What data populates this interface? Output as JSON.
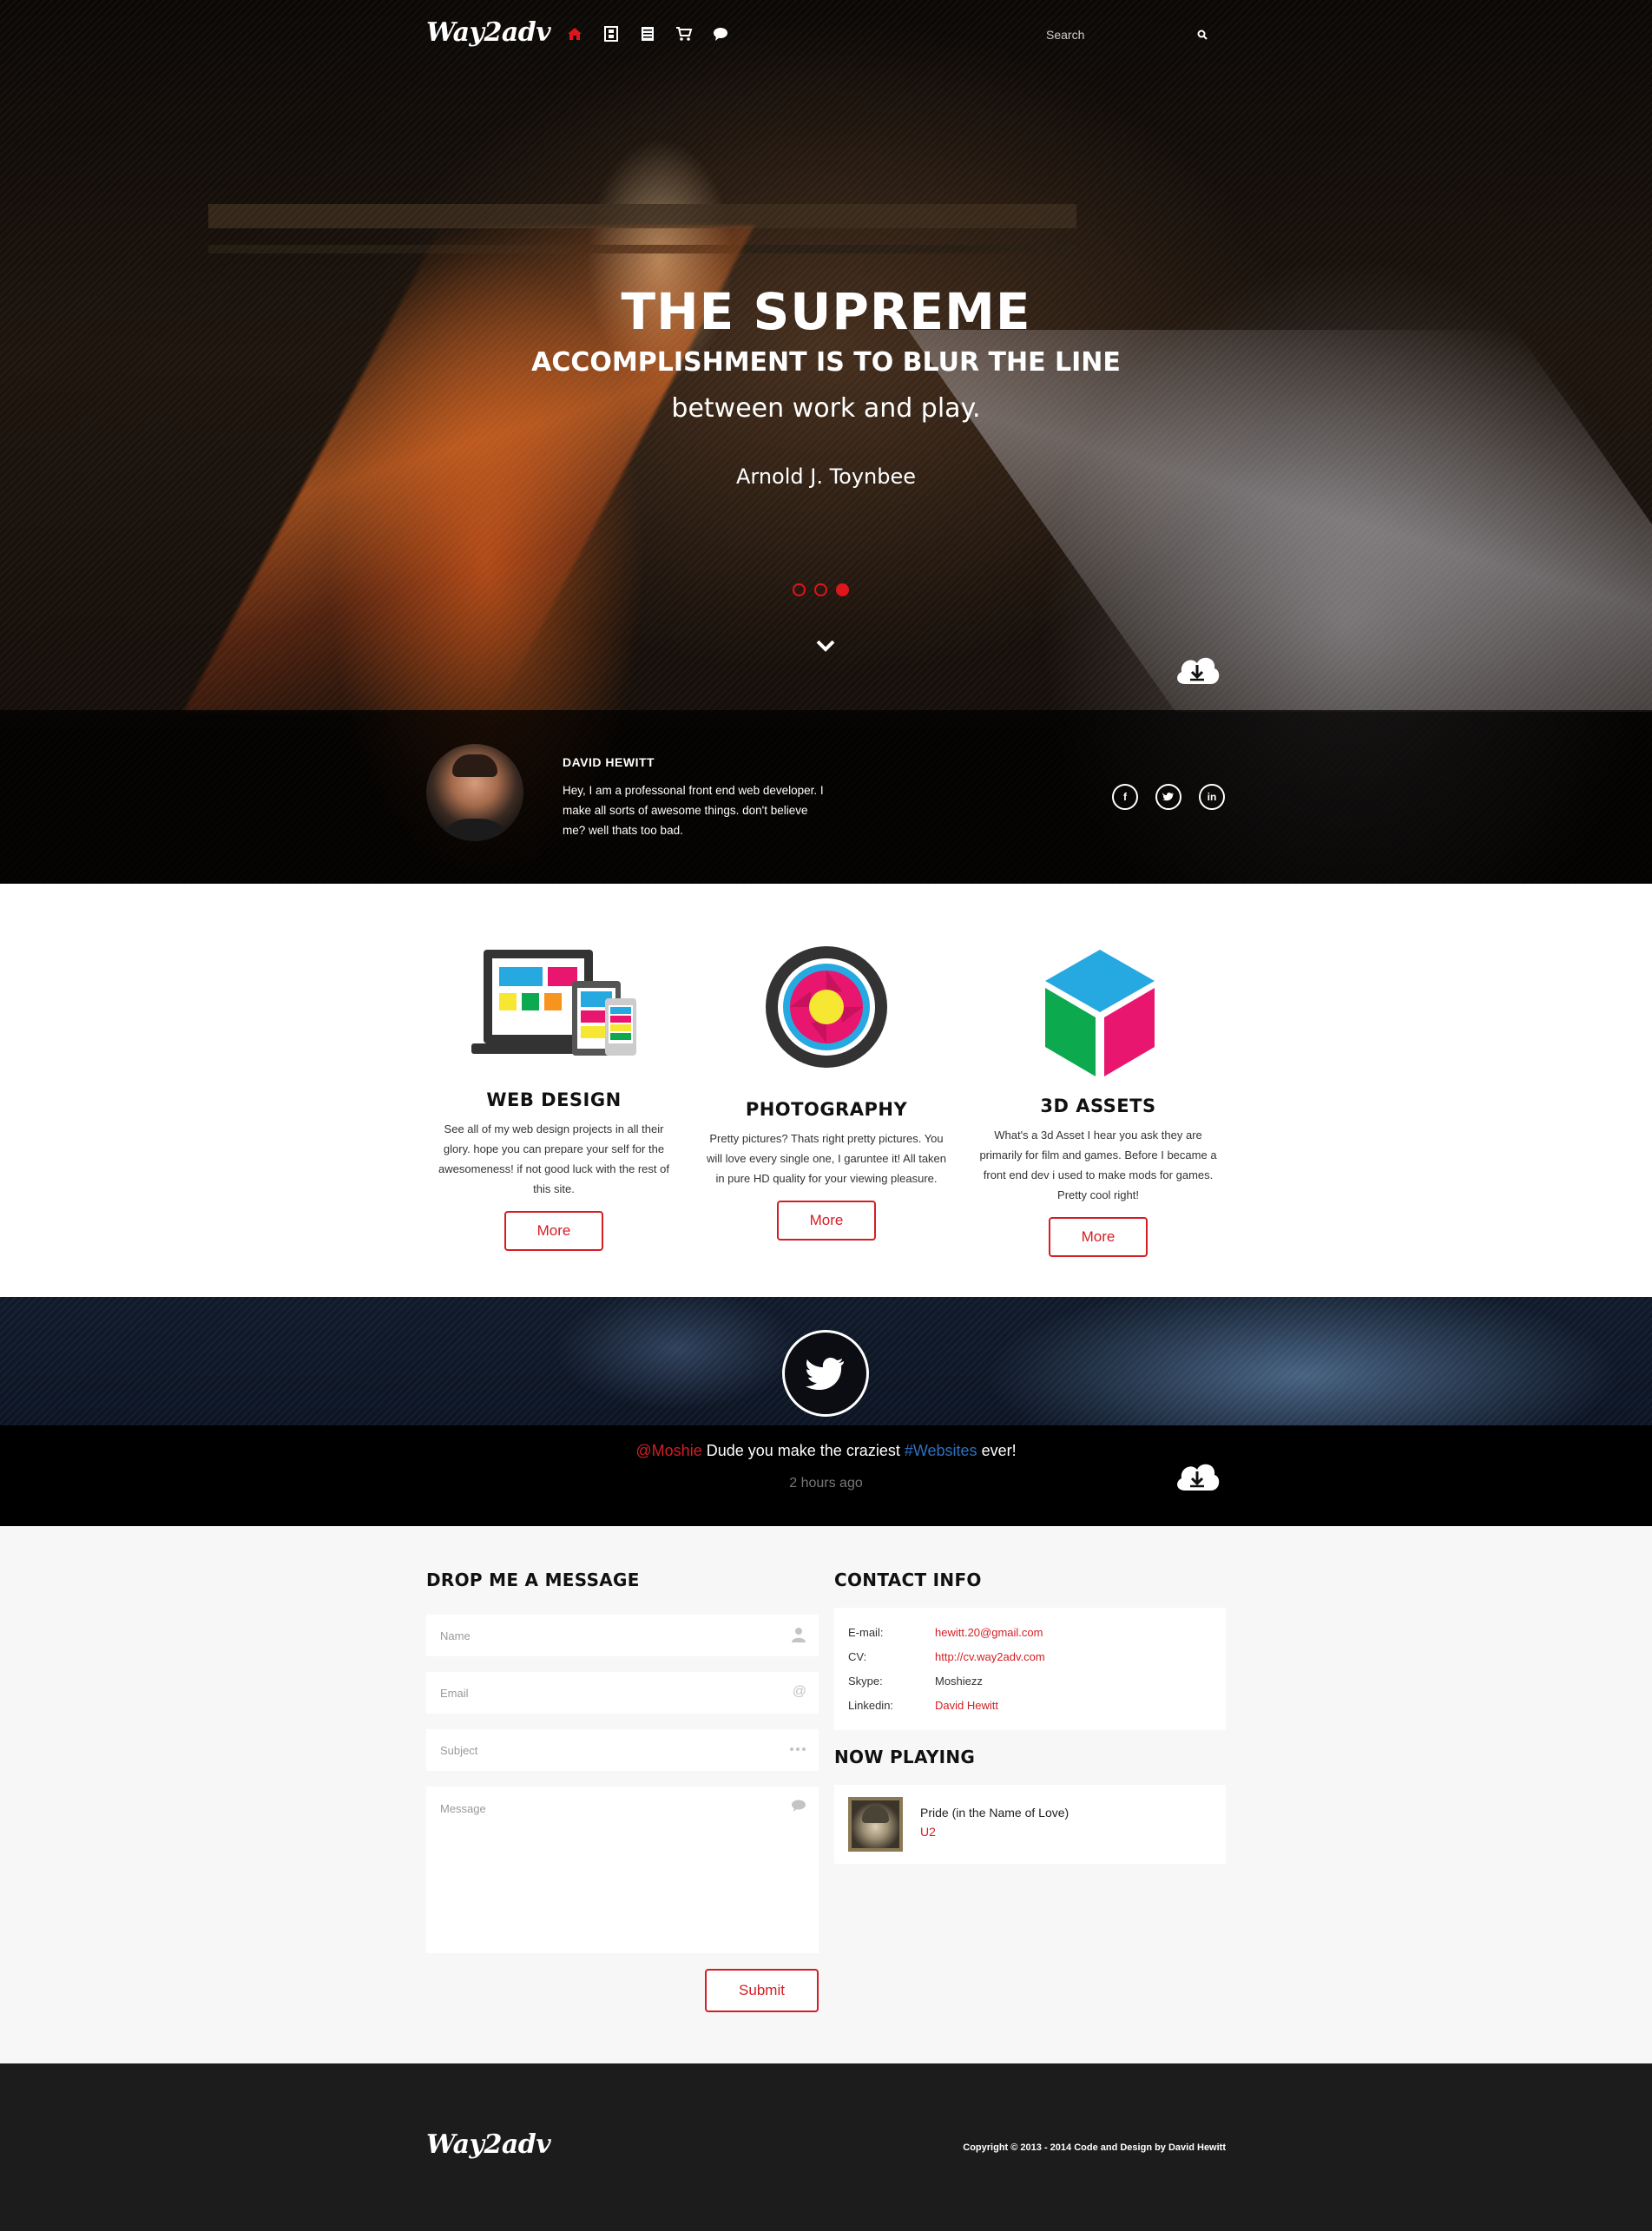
{
  "nav": {
    "logo": "Way2adv",
    "icons": [
      "home-icon",
      "film-icon",
      "list-icon",
      "cart-icon",
      "chat-icon"
    ],
    "search_placeholder": "Search"
  },
  "hero": {
    "line1": "THE SUPREME",
    "line2": "ACCOMPLISHMENT IS TO BLUR THE LINE",
    "line3": "between work and play.",
    "author": "Arnold J. Toynbee",
    "slides": 3,
    "active_slide": 3
  },
  "profile": {
    "name": "DAVID HEWITT",
    "bio": "Hey, I am a professonal front end web developer. I make all sorts of awesome things. don't believe me? well thats too bad.",
    "social": [
      "f",
      "t",
      "in"
    ]
  },
  "services": [
    {
      "title": "WEB DESIGN",
      "text": "See all of my web design projects in all their glory. hope you can prepare your self for the awesomeness! if not good luck with the rest of this site.",
      "button": "More"
    },
    {
      "title": "PHOTOGRAPHY",
      "text": "Pretty pictures? Thats right pretty pictures. You will love every single one, I garuntee it! All taken in pure HD quality for your viewing pleasure.",
      "button": "More"
    },
    {
      "title": "3D ASSETS",
      "text": "What's a 3d Asset I hear you ask they are primarily for film and games. Before I became a front end dev i used to make mods for games. Pretty cool right!",
      "button": "More"
    }
  ],
  "tweet": {
    "handle": "@Moshie",
    "text_before": " Dude you make the craziest ",
    "tag": "#Websites",
    "text_after": " ever!",
    "time": "2 hours ago"
  },
  "contact": {
    "form_title": "DROP ME A MESSAGE",
    "name_placeholder": "Name",
    "email_placeholder": "Email",
    "subject_placeholder": "Subject",
    "message_placeholder": "Message",
    "submit_label": "Submit",
    "info_title": "CONTACT INFO",
    "info": [
      {
        "label": "E-mail:",
        "value": "hewitt.20@gmail.com"
      },
      {
        "label": "CV:",
        "value": "http://cv.way2adv.com"
      },
      {
        "label": "Skype:",
        "value": "Moshiezz"
      },
      {
        "label": "Linkedin:",
        "value": "David Hewitt"
      }
    ],
    "now_playing_title": "NOW PLAYING",
    "song": "Pride (in the Name of Love)",
    "artist": "U2"
  },
  "footer": {
    "logo": "Way2adv",
    "copyright": "Copyright © 2013 - 2014 Code and Design by David Hewitt"
  },
  "colors": {
    "accent": "#d41e24",
    "hashtag": "#2f6fbf",
    "footer_bg": "#1c1c1c",
    "section_bg": "#f7f7f7"
  }
}
